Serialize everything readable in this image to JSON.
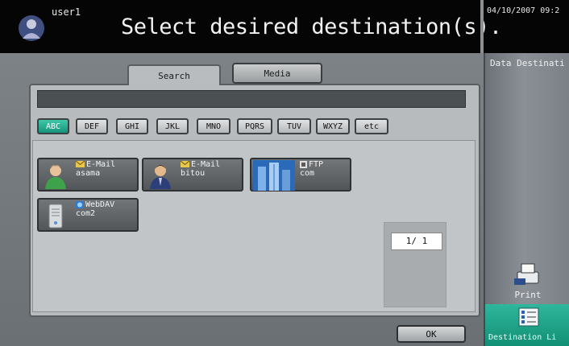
{
  "header": {
    "user": "user1",
    "prompt": "Select desired destination(s).",
    "datetime": "04/10/2007 09:2"
  },
  "tabs": [
    {
      "label": "Search",
      "selected": true
    },
    {
      "label": "Media",
      "selected": false
    }
  ],
  "search": {
    "value": ""
  },
  "index_keys": [
    "ABC",
    "DEF",
    "GHI",
    "JKL",
    "MNO",
    "PQRS",
    "TUV",
    "WXYZ",
    "etc"
  ],
  "selected_index_key": "ABC",
  "destinations": [
    {
      "type": "E-Mail",
      "name": "asama",
      "icon": "person-green-icon"
    },
    {
      "type": "E-Mail",
      "name": "bitou",
      "icon": "person-suit-icon"
    },
    {
      "type": "FTP",
      "name": "com",
      "icon": "building-icon"
    },
    {
      "type": "WebDAV",
      "name": "com2",
      "icon": "server-icon"
    }
  ],
  "pagination": {
    "text": "1/  1"
  },
  "ok_label": "OK",
  "side": {
    "title": "Data Destinati",
    "print_label": "Print",
    "destination_list_label": "Destination Li"
  },
  "colors": {
    "accent": "#1fa88c",
    "background": "#b8bbbd"
  }
}
